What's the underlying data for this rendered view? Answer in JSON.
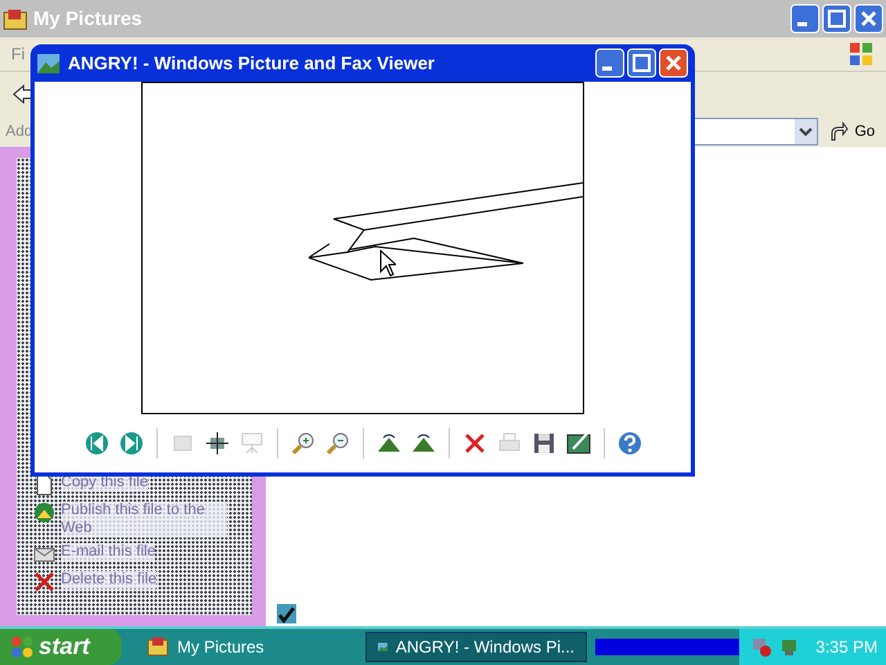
{
  "explorer": {
    "title": "My Pictures",
    "menu": [
      "Fi"
    ],
    "address_label": "Add",
    "go": "Go",
    "tasks": [
      {
        "label": "Copy this file"
      },
      {
        "label": "Publish this file to the Web"
      },
      {
        "label": "E-mail this file"
      },
      {
        "label": "Delete this file"
      }
    ]
  },
  "viewer": {
    "title": "ANGRY! - Windows Picture and Fax Viewer",
    "tools": [
      {
        "kind": "button",
        "disabled": false
      },
      {
        "kind": "button",
        "disabled": false
      },
      {
        "kind": "separator"
      },
      {
        "kind": "button",
        "disabled": true
      },
      {
        "kind": "button",
        "disabled": false
      },
      {
        "kind": "button",
        "disabled": true
      },
      {
        "kind": "separator"
      },
      {
        "kind": "button",
        "disabled": false
      },
      {
        "kind": "button",
        "disabled": false
      },
      {
        "kind": "separator"
      },
      {
        "kind": "button",
        "disabled": false
      },
      {
        "kind": "button",
        "disabled": false
      },
      {
        "kind": "separator"
      },
      {
        "kind": "button",
        "disabled": false
      },
      {
        "kind": "button",
        "disabled": true
      },
      {
        "kind": "button",
        "disabled": false
      },
      {
        "kind": "button",
        "disabled": false
      },
      {
        "kind": "separator"
      },
      {
        "kind": "button",
        "disabled": false
      }
    ]
  },
  "taskbar": {
    "start": "start",
    "tasks": [
      {
        "label": "My Pictures",
        "selected": false
      },
      {
        "label": "ANGRY! - Windows Pi...",
        "selected": true
      }
    ],
    "clock": "3:35 PM"
  }
}
